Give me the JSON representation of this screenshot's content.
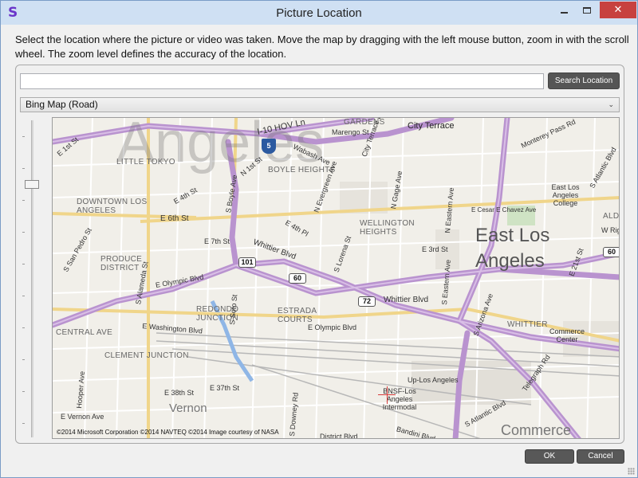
{
  "window": {
    "title": "Picture Location",
    "app_icon": "S",
    "minimize_icon": "minimize-icon",
    "maximize_icon": "maximize-icon",
    "close_glyph": "✕"
  },
  "instructions": "Select the location where the picture or video was taken. Move the map by dragging with the left mouse button, zoom in with the scroll wheel. The zoom level defines the accuracy of the location.",
  "search": {
    "value": "",
    "placeholder": "",
    "button_label": "Search Location"
  },
  "map_type": {
    "selected": "Bing Map (Road)",
    "chevron": "⌄"
  },
  "zoom_slider": {
    "level_fraction": 0.2
  },
  "map": {
    "copyright": "©2014 Microsoft Corporation ©2014 NAVTEQ ©2014 Image courtesy of NASA",
    "watermark": "Angeles",
    "districts": {
      "little_tokyo": "LITTLE TOKYO",
      "downtown": "DOWNTOWN LOS ANGELES",
      "boyle_heights": "BOYLE HEIGHTS",
      "wellington_heights": "WELLINGTON HEIGHTS",
      "produce_district": "PRODUCE DISTRICT",
      "redondo_junction": "REDONDO JUNCTION",
      "estrada_courts": "ESTRADA COURTS",
      "central_ave": "CENTRAL AVE",
      "clement_junction": "CLEMENT JUNCTION",
      "whittier": "WHITTIER",
      "gardens": "GARDENS",
      "east_la_college": "East Los Angeles College",
      "commerce_center": "Commerce Center",
      "bnsf": "BNSF-Los Angeles Intermodal",
      "ald": "ALD"
    },
    "cities": {
      "city_terrace": "City Terrace",
      "east_los_angeles_1": "East Los",
      "east_los_angeles_2": "Angeles",
      "vernon": "Vernon",
      "commerce": "Commerce"
    },
    "streets": {
      "i10_hov": "I-10 HOV Ln",
      "e6th": "E 6th St",
      "e7th": "E 7th St",
      "e4th": "E 4th St",
      "e1st": "E 1st St",
      "n1st": "N 1st St",
      "whittier_blvd_1": "Whittier Blvd",
      "whittier_blvd_2": "Whittier Blvd",
      "e_olympic_1": "E Olympic Blvd",
      "e_olympic_2": "E Olympic Blvd",
      "e_washington": "E Washington Blvd",
      "e3rd": "E 3rd St",
      "e_cesar": "E Cesar E Chavez Ave",
      "monterey_pass": "Monterey Pass Rd",
      "marengo": "Marengo St",
      "wabash": "Wabash Ave",
      "s_alameda": "S Alameda St",
      "s_boyle": "S Boyle Ave",
      "s_lorena": "S Lorena St",
      "s_soto": "S Soto St",
      "s_eastern": "S Eastern Ave",
      "s_arizona": "S Arizona Ave",
      "s_atlantic_1": "S Atlantic Blvd",
      "s_atlantic_2": "S Atlantic Blvd",
      "n_evergreen": "N Evergreen Ave",
      "n_gage": "N Gage Ave",
      "n_eastern": "N Eastern Ave",
      "s_san_pedro": "S San Pedro St",
      "hooper": "Hooper Ave",
      "e38th": "E 38th St",
      "e37th": "E 37th St",
      "e_vernon": "E Vernon Ave",
      "district_blvd": "District Blvd",
      "bandini": "Bandini Blvd",
      "up_los_angeles": "Up-Los Angeles",
      "telegraph": "Telegraph Rd",
      "w_rigg": "W Rigg",
      "e4th_pl": "E 4th Pl",
      "s_downey": "S Downey Rd",
      "e_21st": "E 21st St",
      "city_terrace_dr": "City Terrace Dr"
    },
    "shields": {
      "us101": "101",
      "ca60_a": "60",
      "ca60_b": "60",
      "ca72": "72",
      "i5": "5"
    }
  },
  "footer": {
    "ok_label": "OK",
    "cancel_label": "Cancel"
  }
}
